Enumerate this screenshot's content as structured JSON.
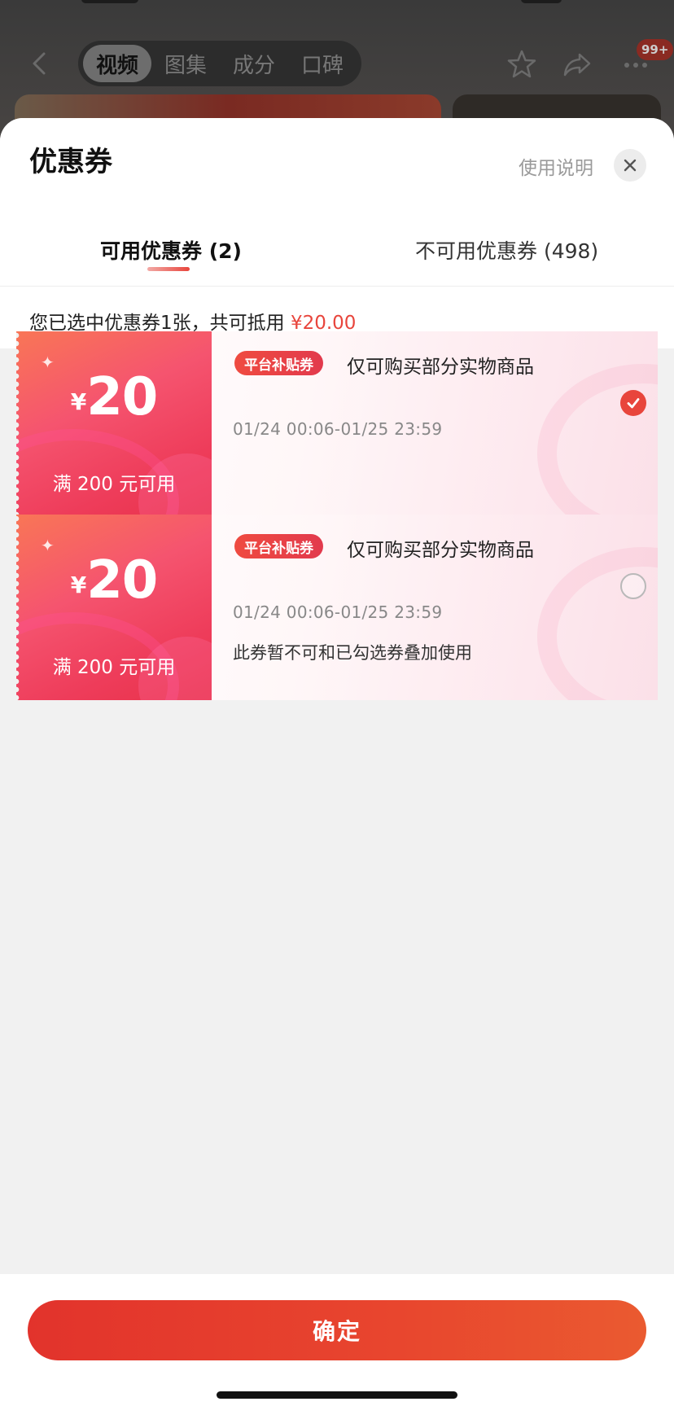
{
  "background": {
    "tabs": [
      "视频",
      "图集",
      "成分",
      "口碑"
    ],
    "active_tab": "视频",
    "badge": "99+"
  },
  "sheet": {
    "title": "优惠券",
    "help_label": "使用说明",
    "tabs": [
      {
        "label": "可用优惠券 (2)",
        "active": true
      },
      {
        "label": "不可用优惠券 (498)",
        "active": false
      }
    ],
    "summary_prefix": "您已选中优惠券1张，共可抵用",
    "summary_amount": "¥20.00"
  },
  "coupons": [
    {
      "currency": "¥",
      "value": "20",
      "condition": "满 200 元可用",
      "tag": "平台补贴券",
      "scope": "仅可购买部分实物商品",
      "validity": "01/24 00:06-01/25 23:59",
      "note": "",
      "selected": true
    },
    {
      "currency": "¥",
      "value": "20",
      "condition": "满 200 元可用",
      "tag": "平台补贴券",
      "scope": "仅可购买部分实物商品",
      "validity": "01/24 00:06-01/25 23:59",
      "note": "此券暂不可和已勾选券叠加使用",
      "selected": false
    }
  ],
  "footer": {
    "confirm_label": "确定"
  },
  "colors": {
    "accent": "#e8453c",
    "coupon_stub": "#f5546f",
    "sheet_bg": "#f1f1f1"
  }
}
